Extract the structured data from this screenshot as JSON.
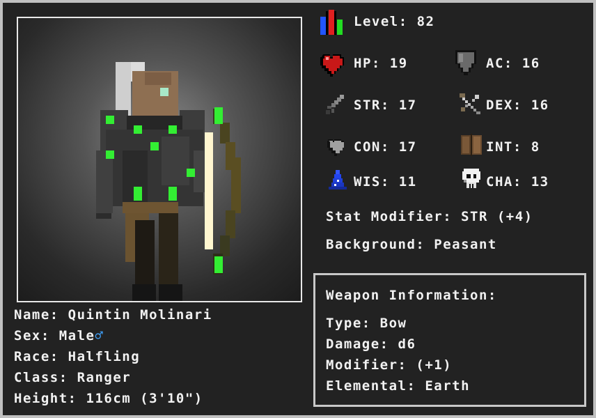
{
  "character": {
    "level_label": "Level: 82",
    "hp_label": "HP: 19",
    "ac_label": "AC: 16",
    "str_label": "STR: 17",
    "dex_label": "DEX: 16",
    "con_label": "CON: 17",
    "int_label": "INT: 8",
    "wis_label": "WIS: 11",
    "cha_label": "CHA: 13",
    "stat_modifier_label": "Stat Modifier: STR (+4)",
    "background_label": "Background: Peasant"
  },
  "identity": {
    "name_label": "Name: Quintin Molinari",
    "sex_label": "Sex: Male",
    "sex_symbol": "♂",
    "race_label": "Race: Halfling",
    "class_label": "Class: Ranger",
    "height_label": "Height: 116cm (3'10\")"
  },
  "weapon": {
    "heading": "Weapon Information:",
    "type_label": "Type: Bow",
    "damage_label": "Damage: d6",
    "modifier_label": "Modifier: (+1)",
    "elemental_label": "Elemental: Earth"
  },
  "colors": {
    "panel_bg": "#222222",
    "frame_bg": "#c0c0c0",
    "text": "#f2f2f2",
    "accent_green": "#33ee33",
    "male_symbol": "#3fa3ff"
  },
  "icons": [
    "level-bars-icon",
    "heart-icon",
    "shield-icon",
    "sword-icon",
    "crossed-weapons-icon",
    "grey-heart-icon",
    "book-icon",
    "wizard-hat-icon",
    "skull-icon"
  ]
}
